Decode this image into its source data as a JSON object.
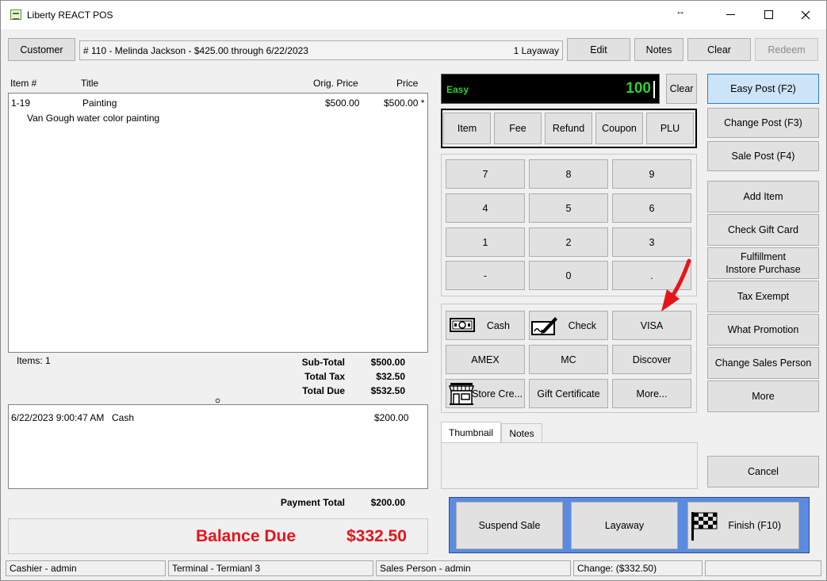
{
  "window": {
    "title": "Liberty REACT POS",
    "resize_glyph": "↔",
    "min_glyph": "—",
    "max_glyph": "☐",
    "close_glyph": "✕"
  },
  "toolbar": {
    "customer_label": "Customer",
    "customer_info": "# 110 - Melinda Jackson -  $425.00 through 6/22/2023",
    "layaway_count": "1 Layaway",
    "edit_label": "Edit",
    "notes_label": "Notes",
    "clear_label": "Clear",
    "redeem_label": "Redeem"
  },
  "items_table": {
    "columns": [
      "Item #",
      "Title",
      "Orig. Price",
      "Price"
    ],
    "rows": [
      {
        "item": "1-19",
        "title": "Painting",
        "orig_price": "$500.00",
        "price": "$500.00 *",
        "description": "Van Gough water color painting"
      }
    ]
  },
  "totals": {
    "items_count": "Items: 1",
    "subtotal_label": "Sub-Total",
    "subtotal": "$500.00",
    "tax_label": "Total Tax",
    "tax": "$32.50",
    "due_label": "Total Due",
    "due": "$532.50"
  },
  "payments": {
    "rows": [
      {
        "datetime": "6/22/2023 9:00:47 AM",
        "method": "Cash",
        "amount": "$200.00"
      }
    ],
    "total_label": "Payment Total",
    "total": "$200.00"
  },
  "balance": {
    "label": "Balance Due",
    "amount": "$332.50",
    "color": "#e8141b"
  },
  "entry": {
    "mode": "Easy",
    "value": "100",
    "clear_label": "Clear",
    "text_color": "#2fd12f"
  },
  "entry_types": [
    "Item",
    "Fee",
    "Refund",
    "Coupon",
    "PLU"
  ],
  "keypad": [
    "7",
    "8",
    "9",
    "4",
    "5",
    "6",
    "1",
    "2",
    "3",
    "-",
    "0",
    "."
  ],
  "tenders": {
    "cash": "Cash",
    "check": "Check",
    "visa": "VISA",
    "amex": "AMEX",
    "mc": "MC",
    "discover": "Discover",
    "store_credit": "Store Cre...",
    "gift_certificate": "Gift Certificate",
    "more": "More..."
  },
  "tabs": {
    "thumbnail": "Thumbnail",
    "notes": "Notes"
  },
  "right_panel": {
    "easy_post": "Easy Post (F2)",
    "change_post": "Change Post (F3)",
    "sale_post": "Sale Post (F4)",
    "add_item": "Add Item",
    "check_gift_card": "Check Gift Card",
    "fulfillment_line1": "Fulfillment",
    "fulfillment_line2": "Instore Purchase",
    "tax_exempt": "Tax Exempt",
    "what_promotion": "What Promotion",
    "change_sales_person": "Change Sales Person",
    "more": "More",
    "cancel": "Cancel"
  },
  "bottom_actions": {
    "suspend": "Suspend Sale",
    "layaway": "Layaway",
    "finish": "Finish (F10)",
    "frame_color": "#5b8be0"
  },
  "status_bar": {
    "cashier": "Cashier - admin",
    "terminal": "Terminal - Termianl 3",
    "sales_person": "Sales Person - admin",
    "change": "Change: ($332.50)"
  },
  "annotation": {
    "arrow_color": "#e8141b"
  }
}
